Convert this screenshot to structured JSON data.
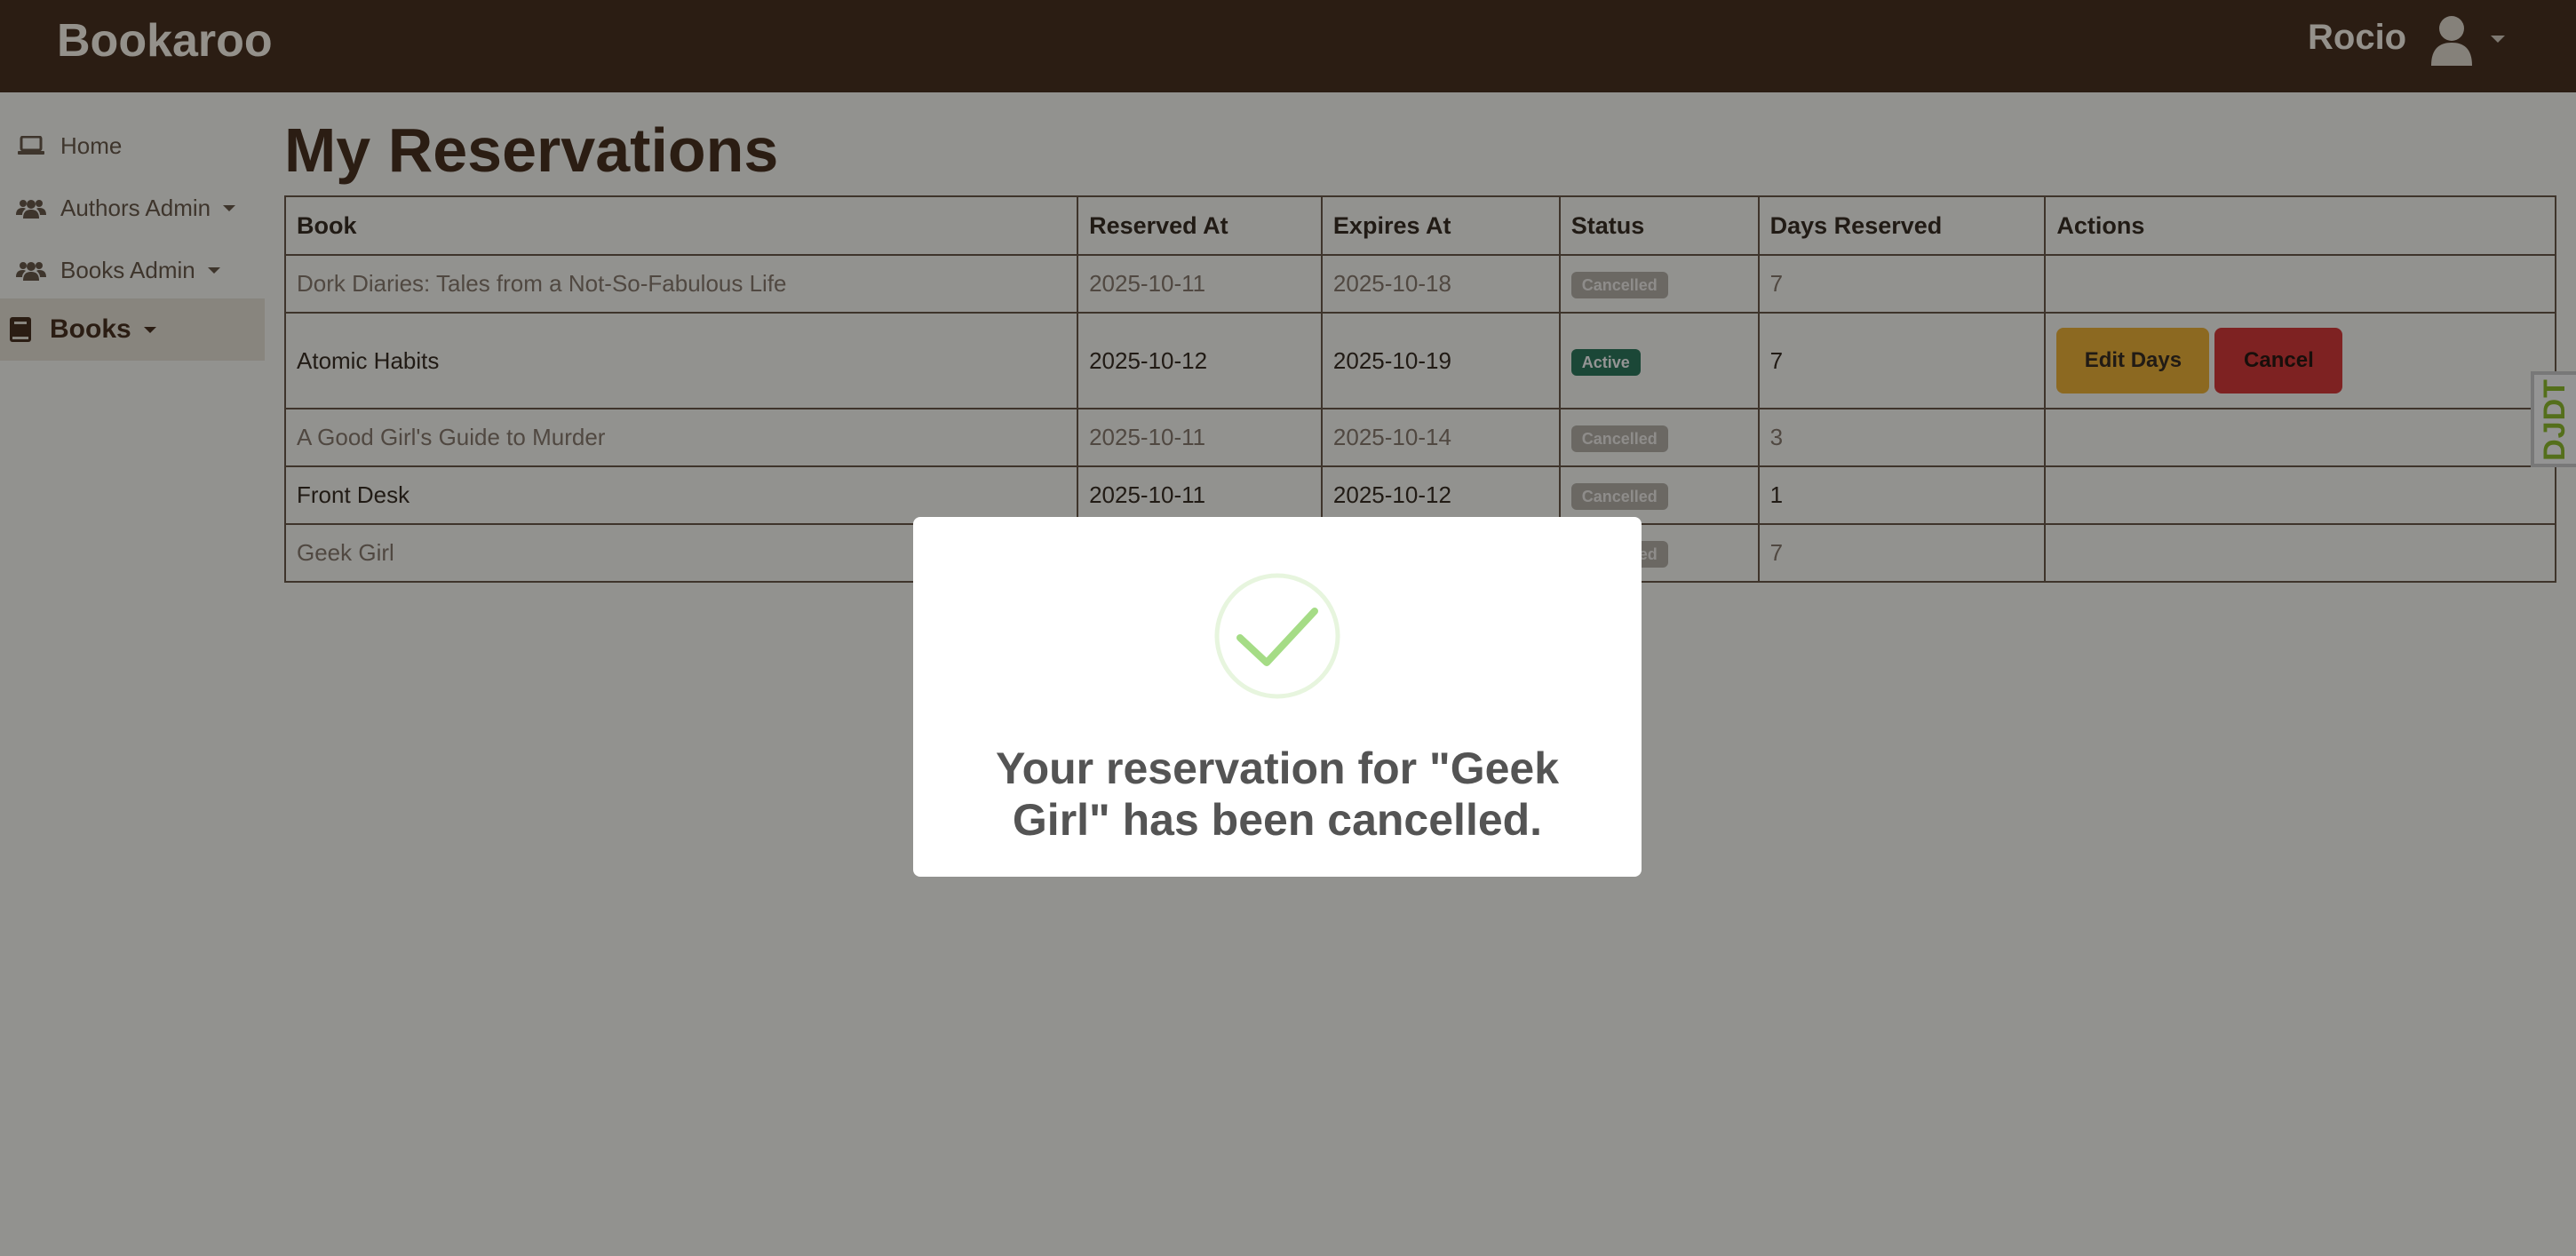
{
  "app": {
    "brand": "Bookaroo"
  },
  "user": {
    "name": "Rocio",
    "avatar_icon": "user-icon"
  },
  "sidebar": {
    "items": [
      {
        "label": "Home",
        "icon": "laptop-icon",
        "has_caret": false,
        "active": false
      },
      {
        "label": "Authors Admin",
        "icon": "users-icon",
        "has_caret": true,
        "active": false
      },
      {
        "label": "Books Admin",
        "icon": "users-icon",
        "has_caret": true,
        "active": false
      },
      {
        "label": "Books",
        "icon": "book-icon",
        "has_caret": true,
        "active": true
      }
    ]
  },
  "page": {
    "title": "My Reservations"
  },
  "table": {
    "headers": [
      "Book",
      "Reserved At",
      "Expires At",
      "Status",
      "Days Reserved",
      "Actions"
    ],
    "rows": [
      {
        "book": "Dork Diaries: Tales from a Not-So-Fabulous Life",
        "reserved_at": "2025-10-11",
        "expires_at": "2025-10-18",
        "status": "Cancelled",
        "days": "7"
      },
      {
        "book": "Atomic Habits",
        "reserved_at": "2025-10-12",
        "expires_at": "2025-10-19",
        "status": "Active",
        "days": "7",
        "actions": {
          "edit": "Edit Days",
          "cancel": "Cancel"
        }
      },
      {
        "book": "A Good Girl's Guide to Murder",
        "reserved_at": "2025-10-11",
        "expires_at": "2025-10-14",
        "status": "Cancelled",
        "days": "3"
      },
      {
        "book": "Front Desk",
        "reserved_at": "2025-10-11",
        "expires_at": "2025-10-12",
        "status": "Cancelled",
        "days": "1"
      },
      {
        "book": "Geek Girl",
        "reserved_at": "",
        "expires_at": "",
        "status": "Cancelled",
        "days": "7"
      }
    ]
  },
  "debug_toolbar": {
    "label": "DJDT"
  },
  "modal": {
    "icon": "success-check-icon",
    "message": "Your reservation for \"Geek Girl\" has been cancelled."
  },
  "colors": {
    "navbar": "#4a3221",
    "warning": "#f2b63a",
    "danger": "#d93b3b",
    "success": "#2f7a5f",
    "success_check": "#a5dc86"
  }
}
